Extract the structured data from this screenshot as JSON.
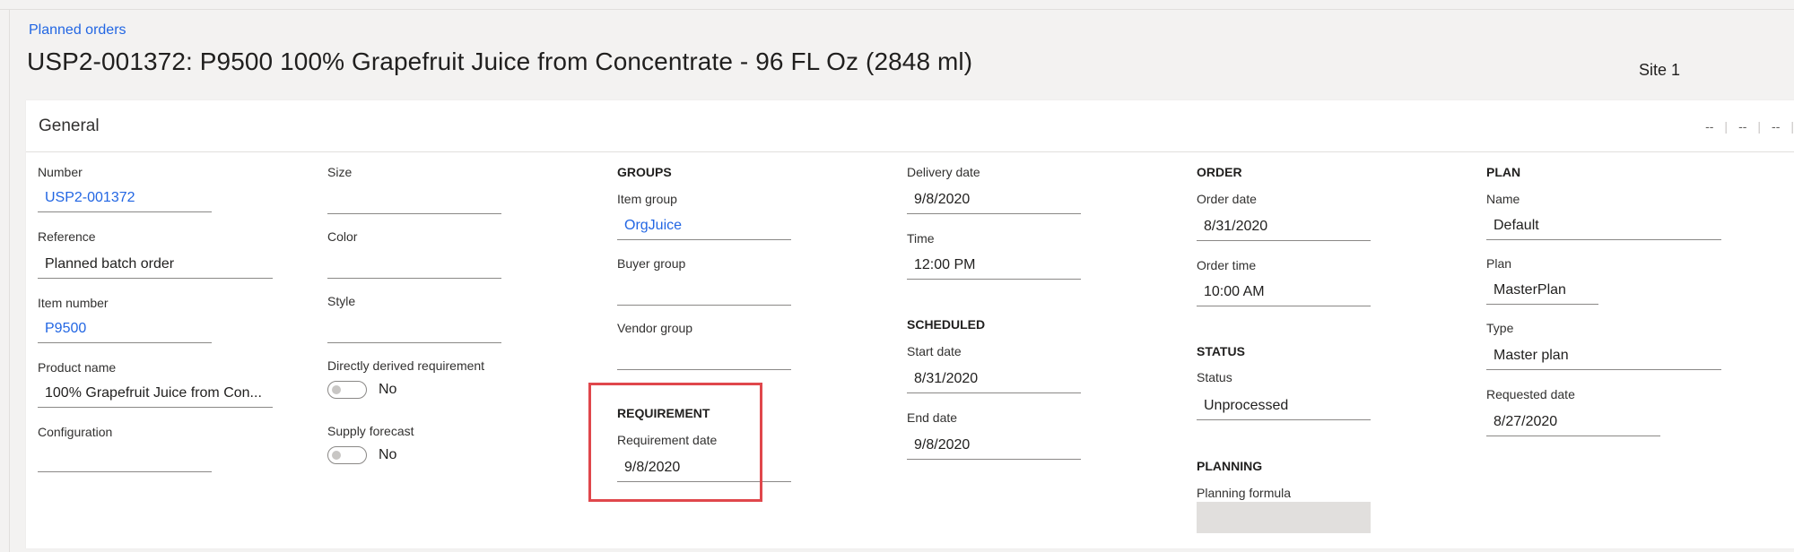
{
  "breadcrumb": "Planned orders",
  "title": "USP2-001372: P9500 100% Grapefruit Juice from Concentrate - 96 FL Oz (2848 ml)",
  "site": "Site 1",
  "general": {
    "title": "General",
    "header_controls": [
      "--",
      "--",
      "--"
    ]
  },
  "col1": {
    "number_label": "Number",
    "number_value": "USP2-001372",
    "reference_label": "Reference",
    "reference_value": "Planned batch order",
    "item_number_label": "Item number",
    "item_number_value": "P9500",
    "product_name_label": "Product name",
    "product_name_value": "100% Grapefruit Juice from Con...",
    "configuration_label": "Configuration",
    "configuration_value": ""
  },
  "col2": {
    "size_label": "Size",
    "size_value": "",
    "color_label": "Color",
    "color_value": "",
    "style_label": "Style",
    "style_value": "",
    "directly_derived_label": "Directly derived requirement",
    "directly_derived_value": "No",
    "supply_forecast_label": "Supply forecast",
    "supply_forecast_value": "No"
  },
  "col3": {
    "groups_header": "GROUPS",
    "item_group_label": "Item group",
    "item_group_value": "OrgJuice",
    "buyer_group_label": "Buyer group",
    "buyer_group_value": "",
    "vendor_group_label": "Vendor group",
    "vendor_group_value": "",
    "requirement_header": "REQUIREMENT",
    "requirement_date_label": "Requirement date",
    "requirement_date_value": "9/8/2020"
  },
  "col4": {
    "delivery_date_label": "Delivery date",
    "delivery_date_value": "9/8/2020",
    "time_label": "Time",
    "time_value": "12:00 PM",
    "scheduled_header": "SCHEDULED",
    "start_date_label": "Start date",
    "start_date_value": "8/31/2020",
    "end_date_label": "End date",
    "end_date_value": "9/8/2020"
  },
  "col5": {
    "order_header": "ORDER",
    "order_date_label": "Order date",
    "order_date_value": "8/31/2020",
    "order_time_label": "Order time",
    "order_time_value": "10:00 AM",
    "status_header": "STATUS",
    "status_label": "Status",
    "status_value": "Unprocessed",
    "planning_header": "PLANNING",
    "planning_formula_label": "Planning formula",
    "planning_formula_value": ""
  },
  "col6": {
    "plan_header": "PLAN",
    "name_label": "Name",
    "name_value": "Default",
    "plan_label": "Plan",
    "plan_value": "MasterPlan",
    "type_label": "Type",
    "type_value": "Master plan",
    "requested_date_label": "Requested date",
    "requested_date_value": "8/27/2020"
  },
  "colors": {
    "link": "#2266e3",
    "highlight": "#e0474c"
  }
}
